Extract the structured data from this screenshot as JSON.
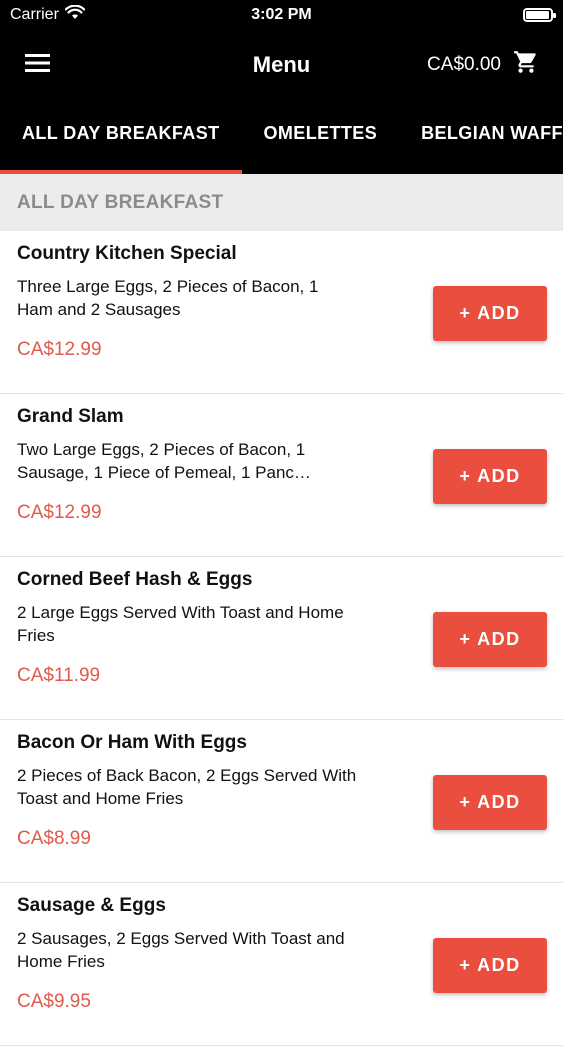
{
  "status": {
    "carrier": "Carrier",
    "time": "3:02 PM",
    "battery_level": 0.95
  },
  "nav": {
    "title": "Menu",
    "cart_total": "CA$0.00"
  },
  "tabs": [
    {
      "label": "ALL DAY BREAKFAST",
      "active": true
    },
    {
      "label": "OMELETTES",
      "active": false
    },
    {
      "label": "BELGIAN WAFFL",
      "active": false
    }
  ],
  "section": {
    "title": "ALL DAY BREAKFAST"
  },
  "items": [
    {
      "name": "Country Kitchen Special",
      "desc": "Three Large Eggs, 2 Pieces of Bacon, 1 Ham and 2 Sausages",
      "price": "CA$12.99",
      "add_label": "+ ADD"
    },
    {
      "name": "Grand Slam",
      "desc": "Two Large Eggs, 2 Pieces of Bacon, 1 Sausage, 1 Piece of Pemeal, 1 Panc…",
      "price": "CA$12.99",
      "add_label": "+ ADD"
    },
    {
      "name": "Corned Beef Hash & Eggs",
      "desc": "2 Large Eggs Served With Toast and Home Fries",
      "price": "CA$11.99",
      "add_label": "+ ADD"
    },
    {
      "name": "Bacon Or Ham With Eggs",
      "desc": "2 Pieces of Back Bacon, 2 Eggs Served With Toast and Home Fries",
      "price": "CA$8.99",
      "add_label": "+ ADD"
    },
    {
      "name": "Sausage & Eggs",
      "desc": "2 Sausages, 2 Eggs Served With Toast and Home Fries",
      "price": "CA$9.95",
      "add_label": "+ ADD"
    }
  ],
  "colors": {
    "accent": "#e94e3e",
    "price": "#e05a4b",
    "header_bg": "#000000",
    "section_bg": "#ececec"
  },
  "icons": {
    "menu": "hamburger-icon",
    "cart": "cart-icon",
    "wifi": "wifi-icon",
    "battery": "battery-icon"
  }
}
